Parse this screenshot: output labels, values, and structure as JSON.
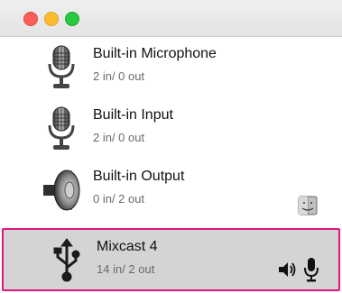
{
  "window": {
    "traffic_lights": [
      {
        "name": "close",
        "color": "#fc5f57"
      },
      {
        "name": "minimize",
        "color": "#fdbc2e"
      },
      {
        "name": "zoom",
        "color": "#28c840"
      }
    ]
  },
  "devices": [
    {
      "name": "Built-in Microphone",
      "io": "2 in/ 0 out",
      "icon": "microphone-icon"
    },
    {
      "name": "Built-in Input",
      "io": "2 in/ 0 out",
      "icon": "microphone-icon"
    },
    {
      "name": "Built-in Output",
      "io": "0 in/ 2 out",
      "icon": "speaker-icon",
      "badge_icon": "finder-icon"
    },
    {
      "name": "Mixcast 4",
      "io": "14 in/ 2 out",
      "icon": "usb-icon",
      "selected": true,
      "status_icons": [
        "speaker-volume-icon",
        "microphone-small-icon"
      ]
    }
  ],
  "colors": {
    "selection_border": "#e0187b",
    "selection_bg": "#d4d4d4"
  }
}
